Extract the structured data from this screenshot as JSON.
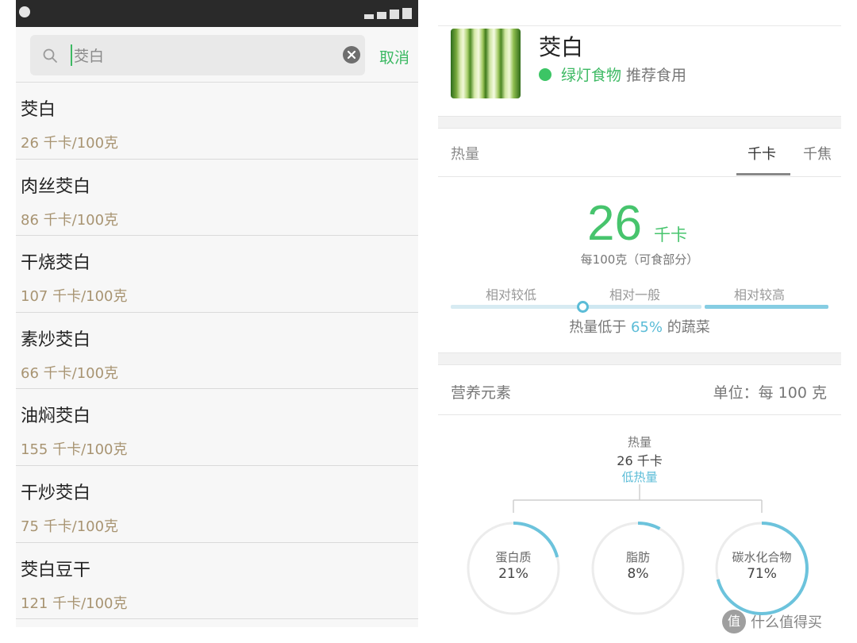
{
  "search": {
    "value": "茭白",
    "cancel_label": "取消"
  },
  "results": [
    {
      "name": "茭白",
      "calories": "26 千卡/100克"
    },
    {
      "name": "肉丝茭白",
      "calories": "86 千卡/100克"
    },
    {
      "name": "干烧茭白",
      "calories": "107 千卡/100克"
    },
    {
      "name": "素炒茭白",
      "calories": "66 千卡/100克"
    },
    {
      "name": "油焖茭白",
      "calories": "155 千卡/100克"
    },
    {
      "name": "干炒茭白",
      "calories": "75 千卡/100克"
    },
    {
      "name": "茭白豆干",
      "calories": "121 千卡/100克"
    }
  ],
  "detail": {
    "title": "茭白",
    "light_label": "绿灯食物",
    "recommend": "推荐食用",
    "calorie_section": {
      "label": "热量",
      "tab_kcal": "千卡",
      "tab_kj": "千焦",
      "value": "26",
      "unit": "千卡",
      "per_note": "每100克（可食部分）",
      "levels": [
        "相对较低",
        "相对一般",
        "相对较高"
      ],
      "compare_prefix": "热量低于",
      "compare_pct": "65%",
      "compare_suffix": "的蔬菜",
      "percentile": 65
    },
    "nutrition": {
      "label": "营养元素",
      "unit_label": "单位：每 100 克",
      "energy_title": "热量",
      "energy_value": "26 千卡",
      "energy_level": "低热量",
      "macros": [
        {
          "name": "蛋白质",
          "pct": "21%",
          "fraction": 0.21
        },
        {
          "name": "脂肪",
          "pct": "8%",
          "fraction": 0.08
        },
        {
          "name": "碳水化合物",
          "pct": "71%",
          "fraction": 0.71
        }
      ]
    }
  },
  "colors": {
    "accent_green": "#3cb963",
    "accent_blue": "#5bbcd7",
    "calorie_text": "#a89472"
  },
  "watermark": {
    "badge": "值",
    "text": "什么值得买"
  }
}
